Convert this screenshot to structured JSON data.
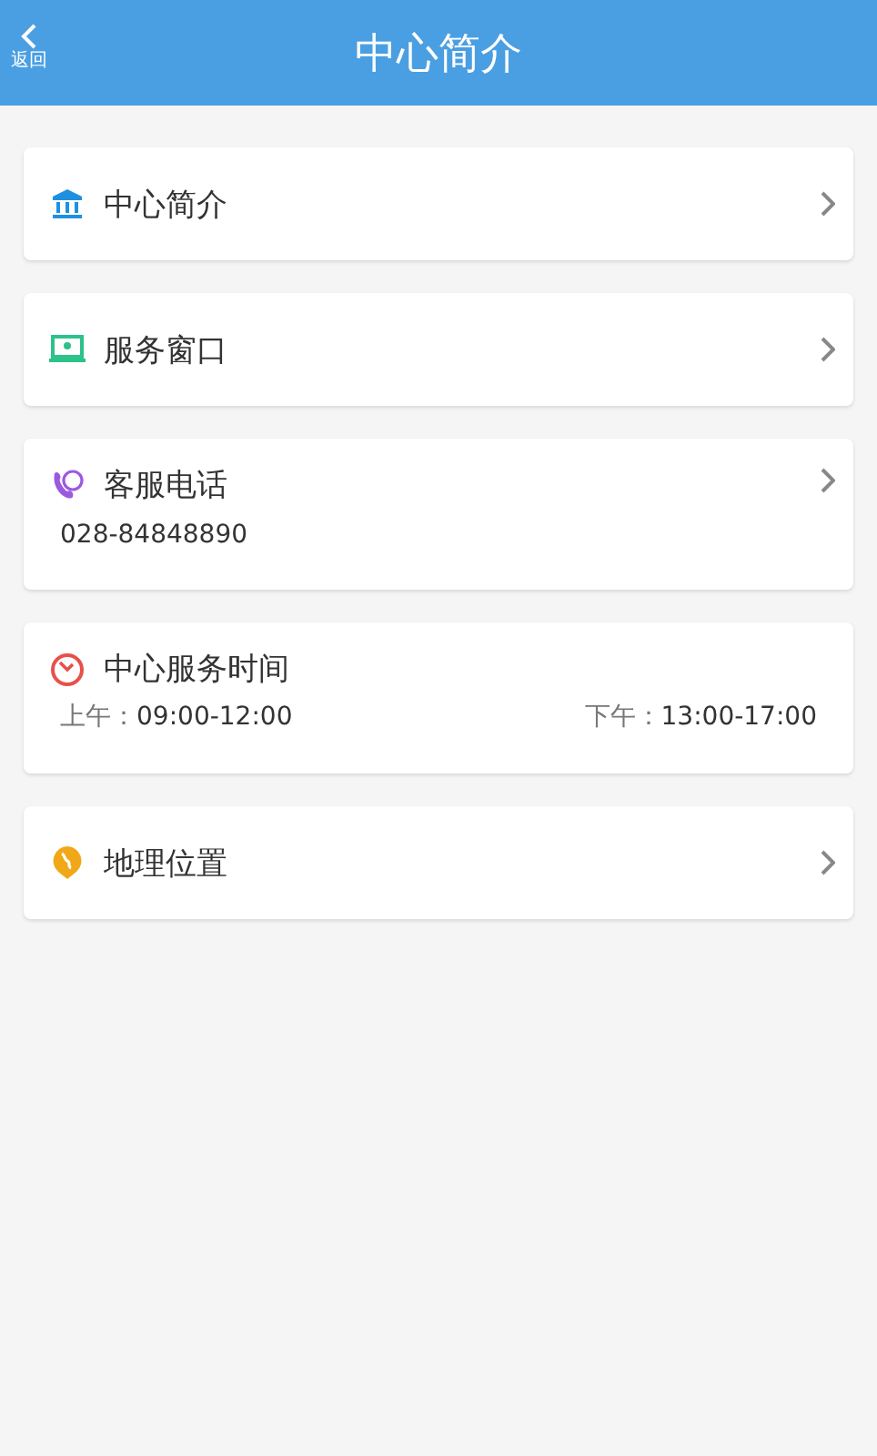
{
  "header": {
    "back_label": "返回",
    "title": "中心简介"
  },
  "cards": [
    {
      "kind": "building",
      "title": "中心简介",
      "arrow": true
    },
    {
      "kind": "window",
      "title": "服务窗口",
      "arrow": true
    },
    {
      "kind": "phone",
      "title": "客服电话",
      "arrow": true,
      "detail": "028-84848890"
    },
    {
      "kind": "clock",
      "title": "中心服务时间",
      "arrow": false,
      "hours": [
        {
          "label": "上午：",
          "time": "09:00-12:00"
        },
        {
          "label": "下午：",
          "time": "13:00-17:00"
        }
      ]
    },
    {
      "kind": "location",
      "title": "地理位置",
      "arrow": true
    }
  ]
}
